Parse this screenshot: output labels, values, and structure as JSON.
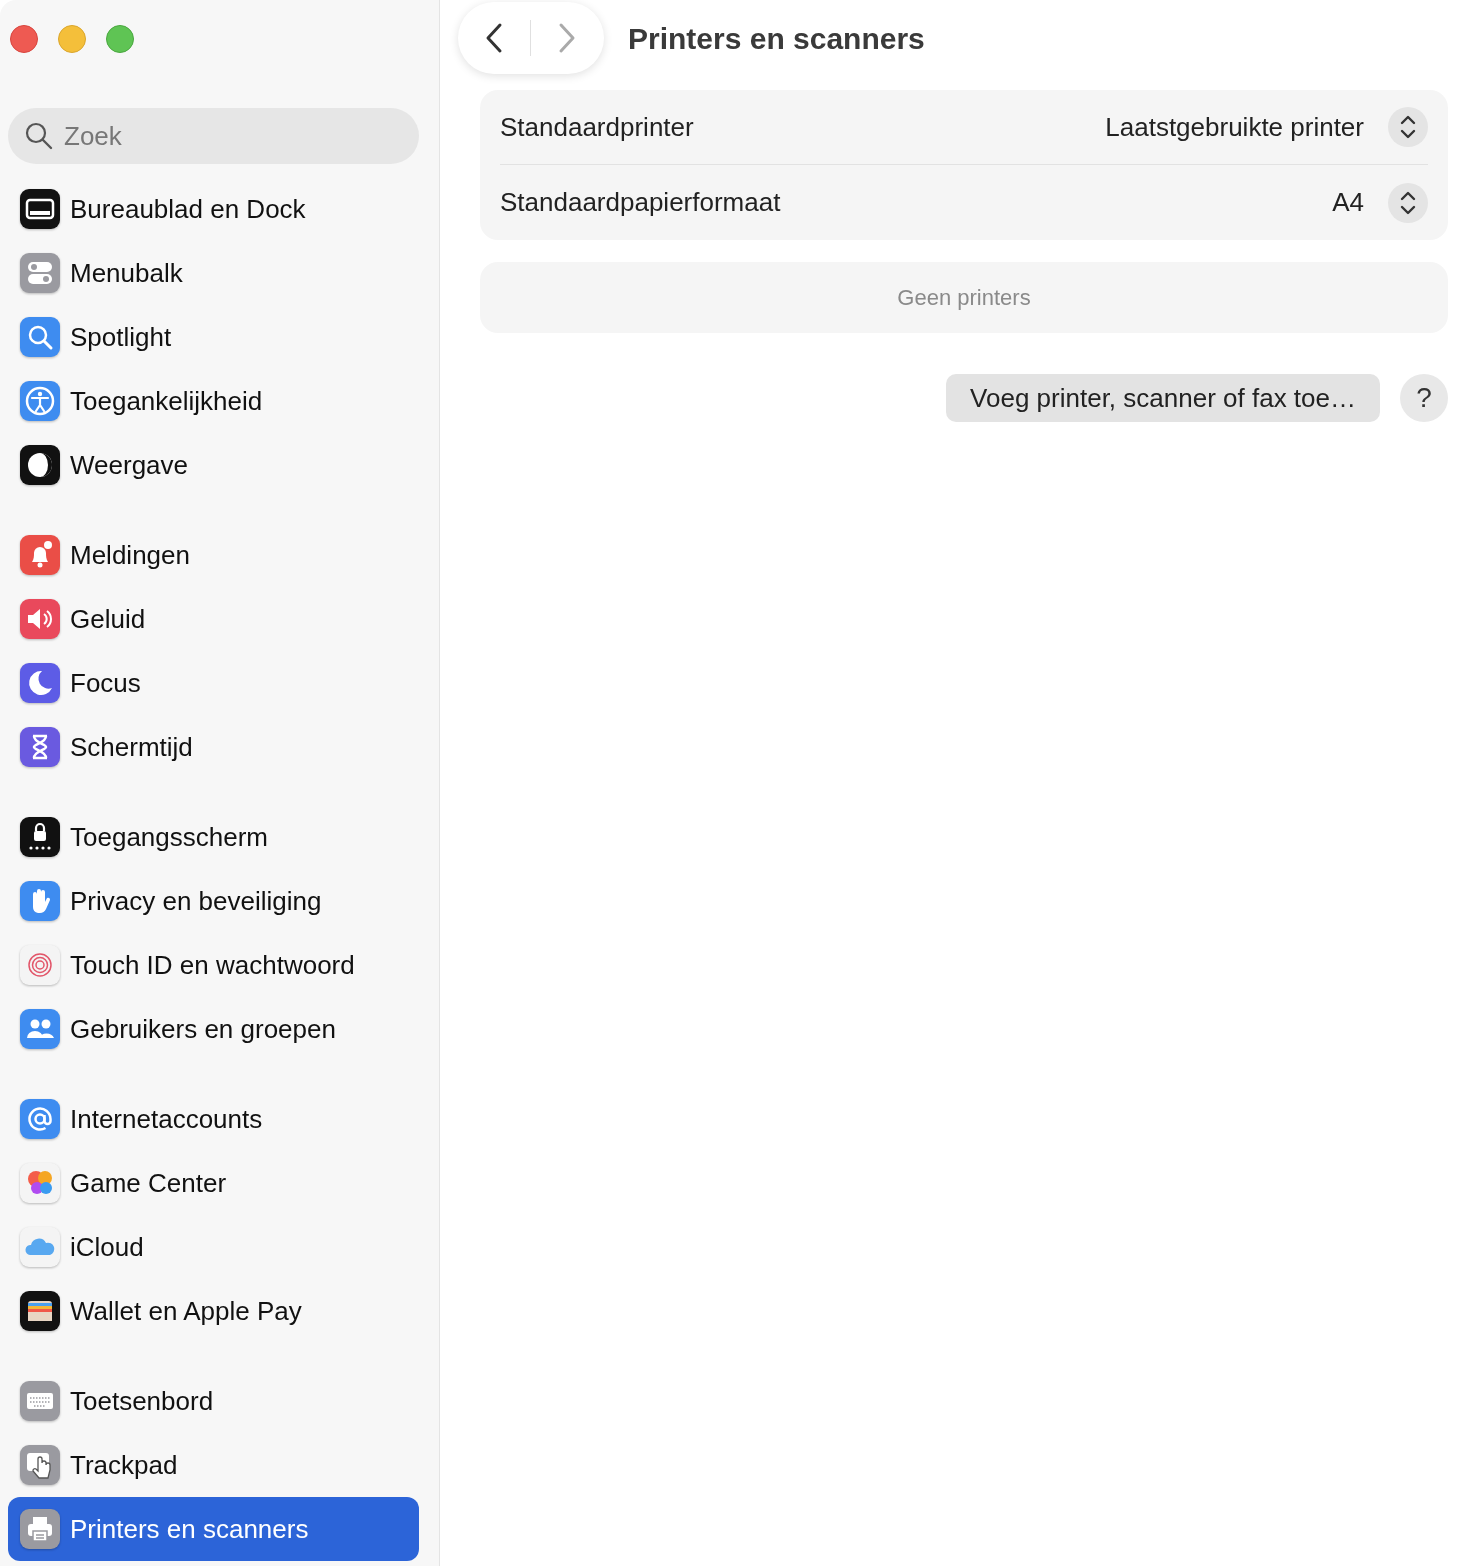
{
  "search": {
    "placeholder": "Zoek"
  },
  "sidebar": {
    "groups": [
      {
        "items": [
          {
            "label": "Bureaublad en Dock",
            "kind": "dock",
            "selected": false
          },
          {
            "label": "Menubalk",
            "kind": "menubar",
            "selected": false
          },
          {
            "label": "Spotlight",
            "kind": "spotlight",
            "selected": false
          },
          {
            "label": "Toegankelijkheid",
            "kind": "accessibility",
            "selected": false
          },
          {
            "label": "Weergave",
            "kind": "appearance",
            "selected": false
          }
        ]
      },
      {
        "items": [
          {
            "label": "Meldingen",
            "kind": "notifications",
            "selected": false
          },
          {
            "label": "Geluid",
            "kind": "sound",
            "selected": false
          },
          {
            "label": "Focus",
            "kind": "focus",
            "selected": false
          },
          {
            "label": "Schermtijd",
            "kind": "screentime",
            "selected": false
          }
        ]
      },
      {
        "items": [
          {
            "label": "Toegangsscherm",
            "kind": "lock",
            "selected": false
          },
          {
            "label": "Privacy en beveiliging",
            "kind": "privacy",
            "selected": false
          },
          {
            "label": "Touch ID en wachtwoord",
            "kind": "touchid",
            "selected": false
          },
          {
            "label": "Gebruikers en groepen",
            "kind": "users",
            "selected": false
          }
        ]
      },
      {
        "items": [
          {
            "label": "Internetaccounts",
            "kind": "internet",
            "selected": false
          },
          {
            "label": "Game Center",
            "kind": "gamecenter",
            "selected": false
          },
          {
            "label": "iCloud",
            "kind": "icloud",
            "selected": false
          },
          {
            "label": "Wallet en Apple Pay",
            "kind": "wallet",
            "selected": false
          }
        ]
      },
      {
        "items": [
          {
            "label": "Toetsenbord",
            "kind": "keyboard",
            "selected": false
          },
          {
            "label": "Trackpad",
            "kind": "trackpad",
            "selected": false
          },
          {
            "label": "Printers en scanners",
            "kind": "printer",
            "selected": true
          }
        ]
      }
    ]
  },
  "toolbar": {
    "title": "Printers en scanners",
    "back_enabled": true,
    "forward_enabled": false
  },
  "settings": [
    {
      "label": "Standaardprinter",
      "value": "Laatstgebruikte printer"
    },
    {
      "label": "Standaardpapierformaat",
      "value": "A4"
    }
  ],
  "printers": {
    "empty_text": "Geen printers"
  },
  "add_button": "Voeg printer, scanner of fax toe…",
  "help_button": "?"
}
